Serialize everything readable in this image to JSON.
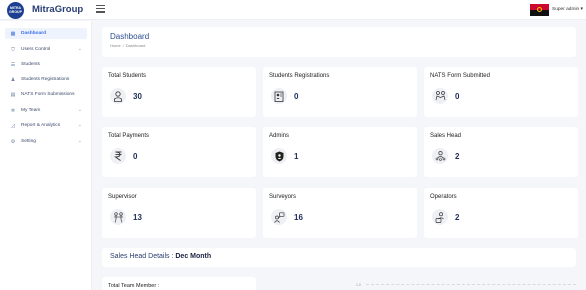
{
  "brand": {
    "logo_text": "MITRA GROUP",
    "name": "MitraGroup"
  },
  "header": {
    "user_menu": "Super admin ▾"
  },
  "sidebar": {
    "items": [
      {
        "label": "Dashboard",
        "icon": "dashboard-icon",
        "glyph": "▦",
        "active": true,
        "has_submenu": false
      },
      {
        "label": "Users Control",
        "icon": "user-shield-icon",
        "glyph": "⛉",
        "active": false,
        "has_submenu": true
      },
      {
        "label": "Students",
        "icon": "list-icon",
        "glyph": "☰",
        "active": false,
        "has_submenu": false
      },
      {
        "label": "Students Registrations",
        "icon": "user-plus-icon",
        "glyph": "♟",
        "active": false,
        "has_submenu": false
      },
      {
        "label": "NATS Form Submissions",
        "icon": "form-icon",
        "glyph": "▤",
        "active": false,
        "has_submenu": false
      },
      {
        "label": "My Team",
        "icon": "team-icon",
        "glyph": "✲",
        "active": false,
        "has_submenu": true
      },
      {
        "label": "Report & Analytics",
        "icon": "chart-icon",
        "glyph": "◿",
        "active": false,
        "has_submenu": true
      },
      {
        "label": "Setting",
        "icon": "gear-icon",
        "glyph": "⚙",
        "active": false,
        "has_submenu": true
      }
    ]
  },
  "page": {
    "title": "Dashboard",
    "breadcrumb": [
      "Home",
      "Dashboard"
    ],
    "breadcrumb_sep": "/"
  },
  "stats": [
    {
      "title": "Total Students",
      "value": "30",
      "icon": "student-icon"
    },
    {
      "title": "Students Registrations",
      "value": "0",
      "icon": "registration-form-icon"
    },
    {
      "title": "NATS Form Submitted",
      "value": "0",
      "icon": "handshake-icon"
    },
    {
      "title": "Total Payments",
      "value": "0",
      "icon": "rupee-icon"
    },
    {
      "title": "Admins",
      "value": "1",
      "icon": "admin-shield-icon"
    },
    {
      "title": "Sales Head",
      "value": "2",
      "icon": "manager-icon"
    },
    {
      "title": "Supervisor",
      "value": "13",
      "icon": "supervisor-icon"
    },
    {
      "title": "Surveyors",
      "value": "16",
      "icon": "survey-icon"
    },
    {
      "title": "Operators",
      "value": "2",
      "icon": "operator-icon"
    }
  ],
  "sales_head": {
    "label": "Sales Head Details : ",
    "period": "Dec Month"
  },
  "team": {
    "title": "Total Team Member :"
  },
  "chart_stub": {
    "tick": "1.0"
  },
  "colors": {
    "accent": "#3a6ee8",
    "brand": "#273c75",
    "background": "#f4f6fa"
  }
}
